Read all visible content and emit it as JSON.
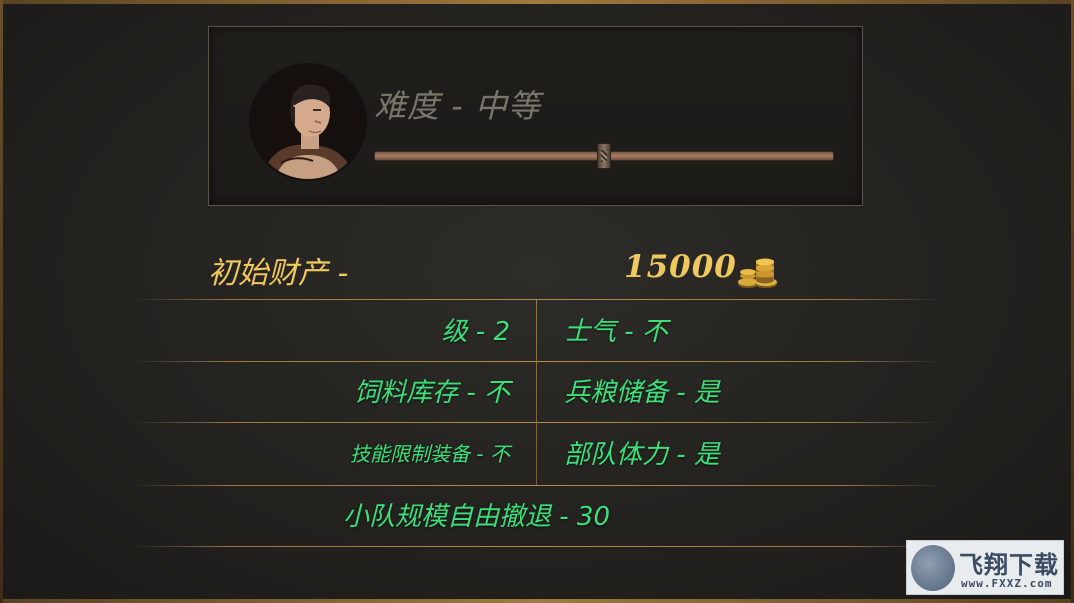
{
  "difficulty": {
    "label": "难度 - 中等",
    "slider_level": 0.5
  },
  "wealth": {
    "label": "初始财产 -",
    "amount": "15000",
    "icon": "gold-coins-icon"
  },
  "settings": {
    "rows": [
      {
        "left": "级 - 2",
        "right": "士气 - 不"
      },
      {
        "left": "饲料库存 - 不",
        "right": "兵粮储备 - 是"
      },
      {
        "left": "技能限制装备 - 不",
        "right": "部队体力 - 是"
      }
    ],
    "squad": "小队规模自由撤退 - 30"
  },
  "watermark": {
    "name": "飞翔下载",
    "url": "www.FXXZ.com"
  },
  "colors": {
    "gold_text": "#f0c860",
    "green_text": "#3ce07a",
    "divider": "#b58a52"
  }
}
